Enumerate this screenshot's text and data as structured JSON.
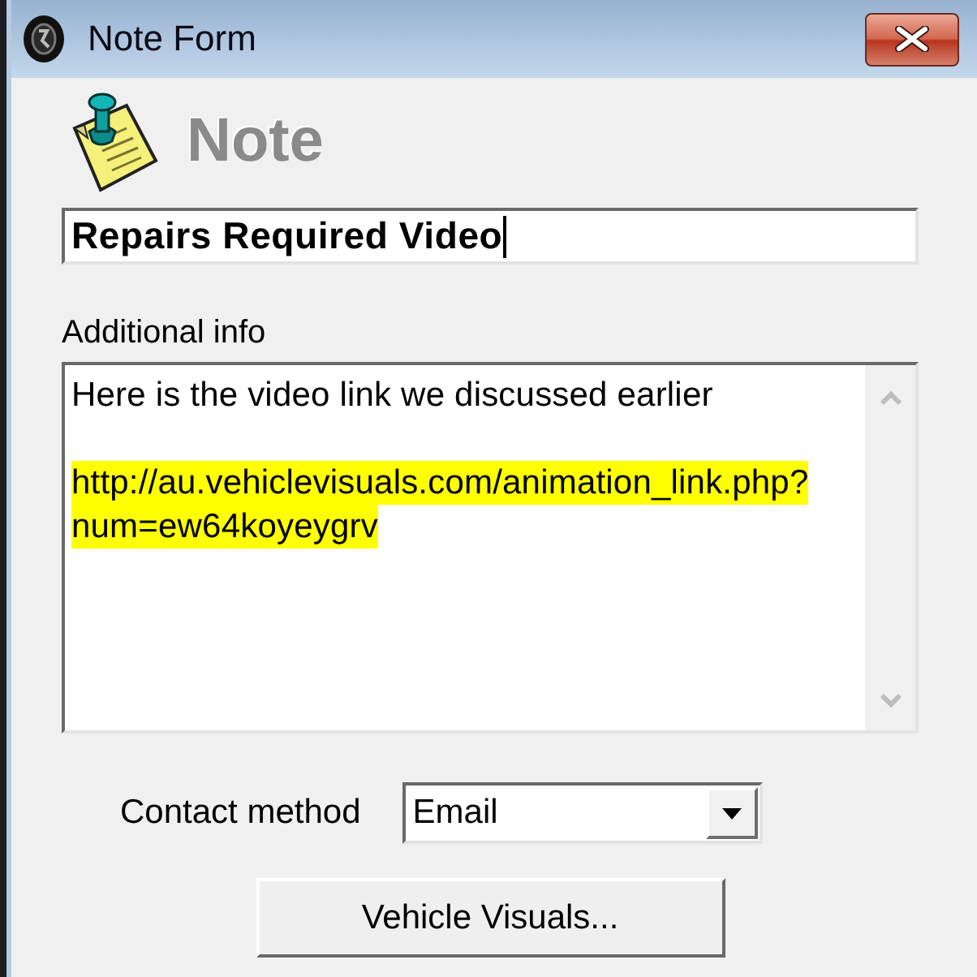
{
  "window": {
    "title": "Note Form"
  },
  "header": {
    "title": "Note"
  },
  "title_field": {
    "value": "Repairs Required Video",
    "focused": true
  },
  "additional_info": {
    "label": "Additional info",
    "paragraphs": [
      {
        "lines": [
          "Here is the video link we discussed earlier"
        ],
        "highlighted": false
      },
      {
        "lines": [
          "http://au.vehiclevisuals.com/animation_link.php?",
          "num=ew64koyeygrv"
        ],
        "highlighted": true
      }
    ]
  },
  "contact_method": {
    "label": "Contact method",
    "value": "Email"
  },
  "buttons": [
    {
      "label": "Vehicle Visuals..."
    }
  ]
}
